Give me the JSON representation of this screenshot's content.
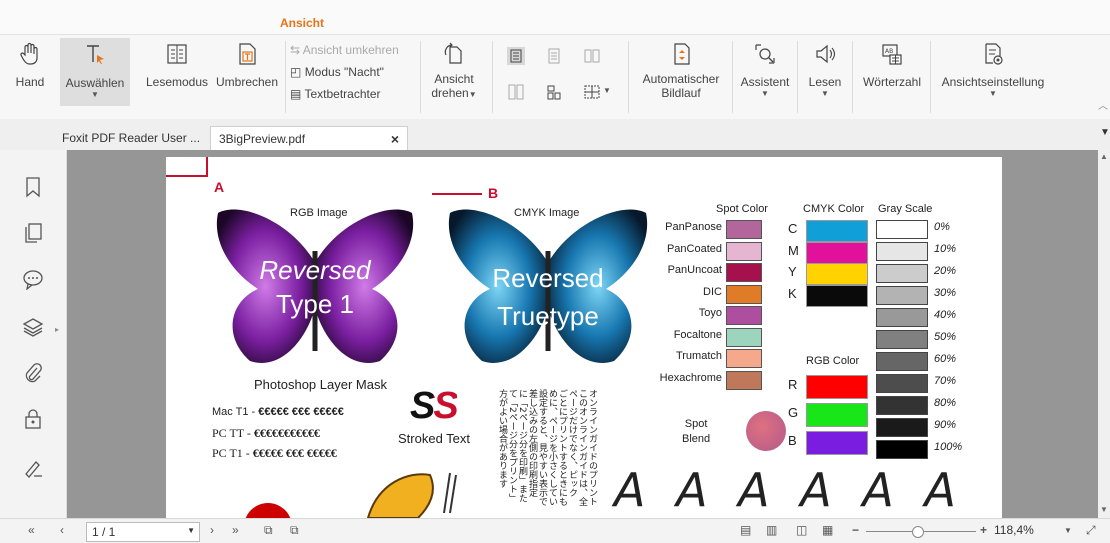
{
  "ribbon": {
    "active_tab": "Ansicht",
    "hand": "Hand",
    "select": "Auswählen",
    "read_mode": "Lesemodus",
    "reflow": "Umbrechen",
    "reverse_view": "Ansicht umkehren",
    "night_mode": "Modus \"Nacht\"",
    "text_viewer": "Textbetrachter",
    "rotate_l1": "Ansicht",
    "rotate_l2": "drehen",
    "autoscroll_l1": "Automatischer",
    "autoscroll_l2": "Bildlauf",
    "assistant": "Assistent",
    "read": "Lesen",
    "word_count": "Wörterzahl",
    "view_settings": "Ansichtseinstellung"
  },
  "tabs": [
    {
      "label": "Foxit PDF Reader User ..."
    },
    {
      "label": "3BigPreview.pdf",
      "close": "×"
    }
  ],
  "status": {
    "page_value": "1 / 1",
    "zoom": "118,4%"
  },
  "pdf": {
    "label_a": "A",
    "label_b": "B",
    "rgb_image": "RGB Image",
    "cmyk_image": "CMYK Image",
    "rev_type1_l1": "Reversed",
    "rev_type1_l2": "Type 1",
    "rev_tt_l1": "Reversed",
    "rev_tt_l2": "Truetype",
    "layer_mask": "Photoshop Layer Mask",
    "mac_t1": "Mac T1 - ",
    "pc_tt": "PC TT - ",
    "pc_t1": "PC T1 - ",
    "euro_row": "€€€€€ €€€ €€€€€",
    "euro_row2": "€€€€€€€€€€€",
    "ss": "SS",
    "stroked_text": "Stroked Text",
    "spot_color": "Spot Color",
    "cmyk_color": "CMYK Color",
    "gray_scale": "Gray Scale",
    "rgb_color": "RGB Color",
    "spot_blend_l1": "Spot",
    "spot_blend_l2": "Blend",
    "big_a": "A A A A A A",
    "jp_cols": [
      "オンラインガイドのプリント",
      "このオンラインガイドは、全",
      "ページだけでなく、ピック",
      "ごとにプリントするときにも",
      "めに、ページを小さくしてい",
      "設定すると、見やすい表示で",
      "差し込みの左側の印刷指定",
      "に「2ページ分を印刷」また",
      "て「2ページ分をプリント」",
      "方がよい場合があります"
    ],
    "spot": [
      {
        "name": "PanPanose",
        "color": "#b2669c"
      },
      {
        "name": "PanCoated",
        "color": "#e6b5d2"
      },
      {
        "name": "PanUncoat",
        "color": "#a6114d"
      },
      {
        "name": "DIC",
        "color": "#e07b27"
      },
      {
        "name": "Toyo",
        "color": "#ad4e9f"
      },
      {
        "name": "Focaltone",
        "color": "#9cd4bd"
      },
      {
        "name": "Trumatch",
        "color": "#f5a88c"
      },
      {
        "name": "Hexachrome",
        "color": "#c0785a"
      }
    ],
    "cmyk": [
      {
        "name": "C",
        "color": "#10a0d7"
      },
      {
        "name": "M",
        "color": "#e2119b"
      },
      {
        "name": "Y",
        "color": "#ffd200"
      },
      {
        "name": "K",
        "color": "#0a0a0a"
      }
    ],
    "rgb": [
      {
        "name": "R",
        "color": "#ff0000"
      },
      {
        "name": "G",
        "color": "#19e619"
      },
      {
        "name": "B",
        "color": "#7a1de0"
      }
    ],
    "gray": [
      {
        "pct": "0%",
        "color": "#ffffff"
      },
      {
        "pct": "10%",
        "color": "#e6e6e6"
      },
      {
        "pct": "20%",
        "color": "#cccccc"
      },
      {
        "pct": "30%",
        "color": "#b3b3b3"
      },
      {
        "pct": "40%",
        "color": "#999999"
      },
      {
        "pct": "50%",
        "color": "#808080"
      },
      {
        "pct": "60%",
        "color": "#666666"
      },
      {
        "pct": "70%",
        "color": "#4d4d4d"
      },
      {
        "pct": "80%",
        "color": "#333333"
      },
      {
        "pct": "90%",
        "color": "#1a1a1a"
      },
      {
        "pct": "100%",
        "color": "#000000"
      }
    ]
  }
}
